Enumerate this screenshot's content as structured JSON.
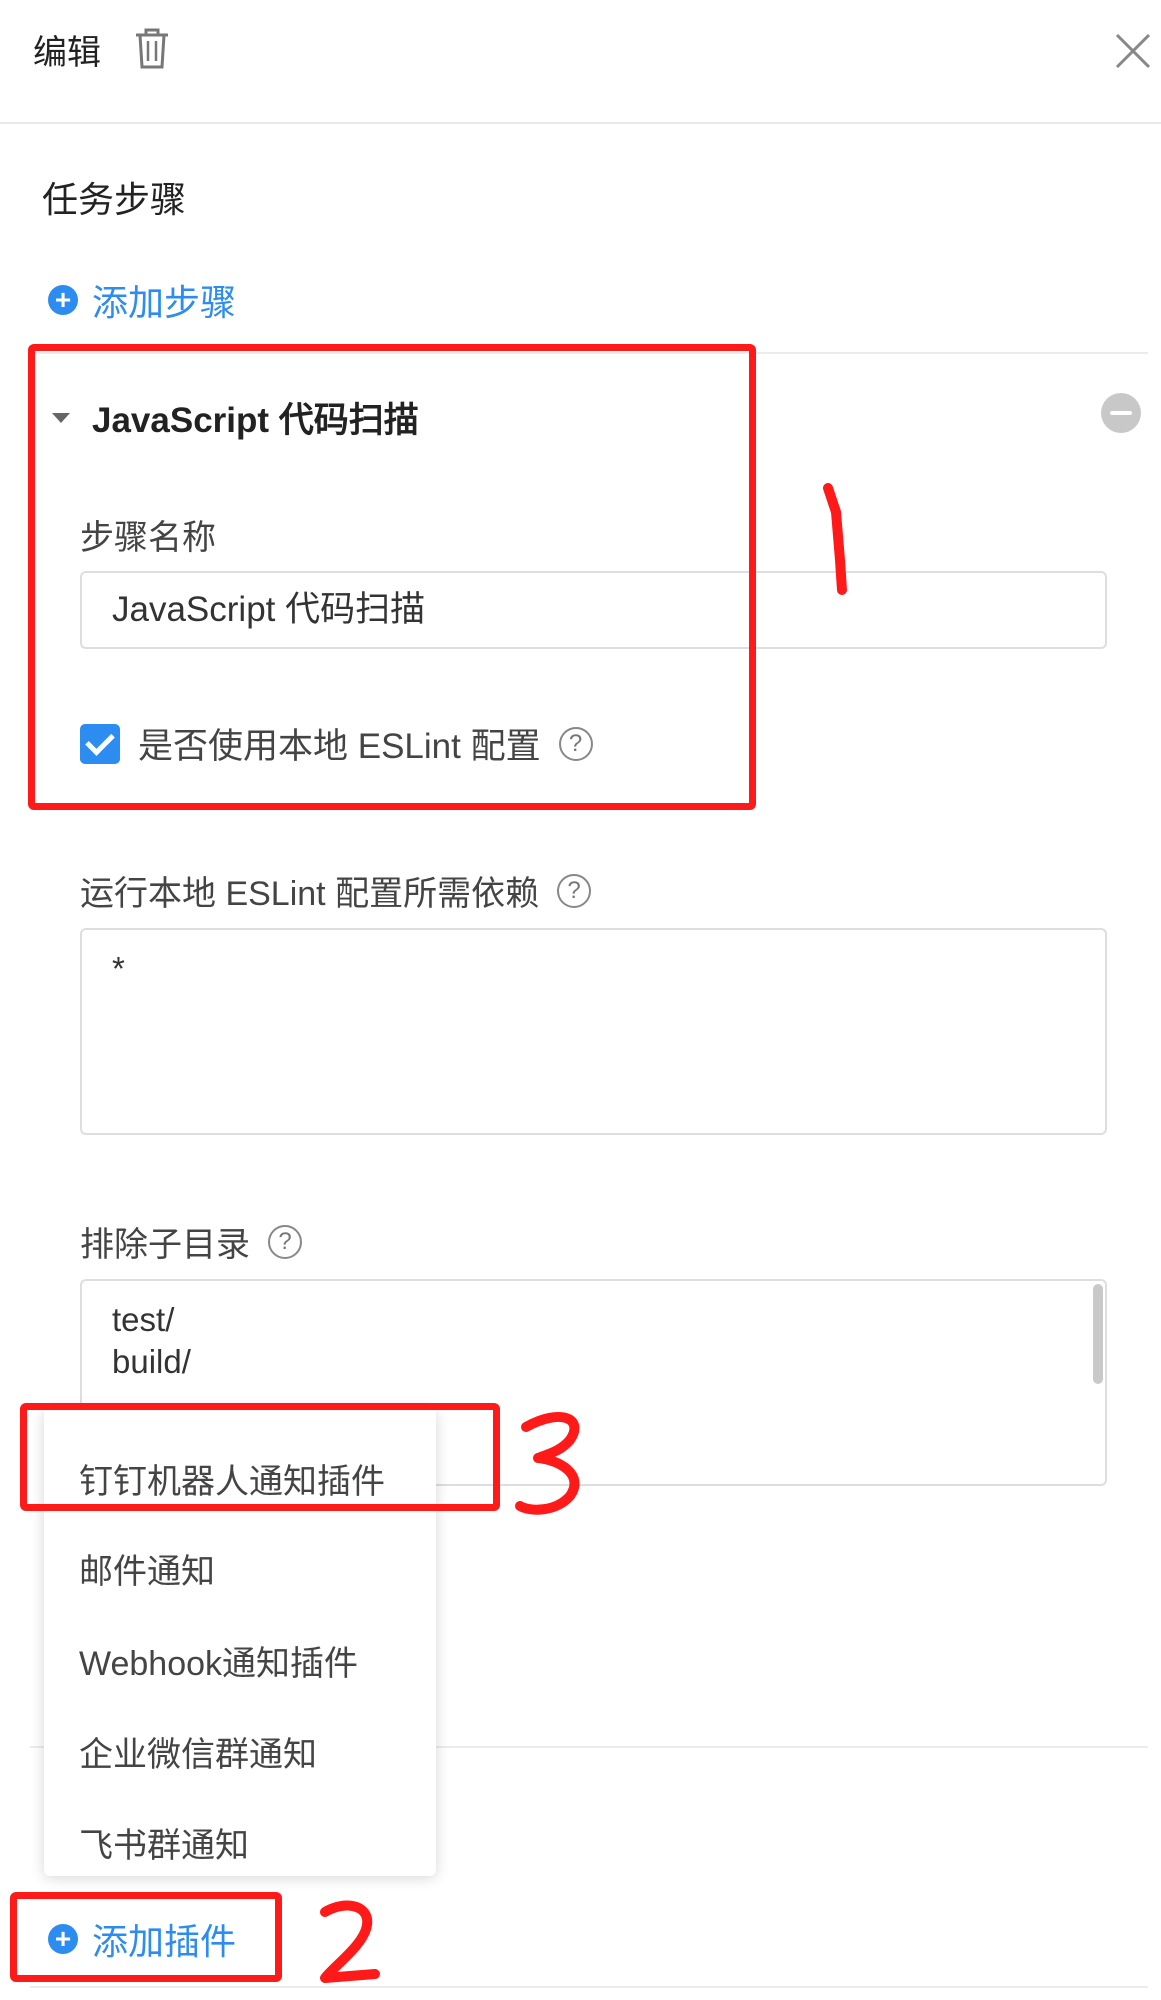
{
  "header": {
    "title": "编辑",
    "trash_icon": "trash-icon",
    "close_icon": "close-icon"
  },
  "task_steps": {
    "title": "任务步骤",
    "add_step_label": "添加步骤"
  },
  "step": {
    "title": "JavaScript 代码扫描",
    "name_label": "步骤名称",
    "name_value": "JavaScript 代码扫描",
    "use_local_eslint_label": "是否使用本地 ESLint 配置",
    "use_local_eslint_checked": true,
    "deps_label": "运行本地 ESLint 配置所需依赖",
    "deps_value": "*",
    "exclude_label": "排除子目录",
    "exclude_value": "test/\nbuild/"
  },
  "plugin_menu": {
    "items": [
      "钉钉机器人通知插件",
      "邮件通知",
      "Webhook通知插件",
      "企业微信群通知",
      "飞书群通知"
    ]
  },
  "plugins": {
    "add_plugin_label": "添加插件"
  },
  "annotations": {
    "marks": [
      "1",
      "2",
      "3"
    ],
    "color": "#ff1a1a"
  },
  "colors": {
    "accent": "#2d8cf0",
    "border": "#dcdee2"
  }
}
